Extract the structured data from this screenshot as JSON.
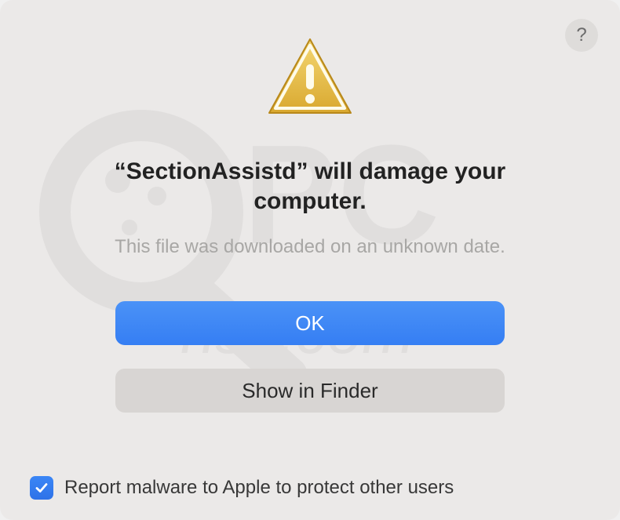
{
  "dialog": {
    "title": "“SectionAssistd” will damage your computer.",
    "subtitle": "This file was downloaded on an unknown date.",
    "primary_button": "OK",
    "secondary_button": "Show in Finder",
    "checkbox_label": "Report malware to Apple to protect other users",
    "checkbox_checked": true,
    "help_label": "?"
  },
  "icons": {
    "warning": "warning-triangle",
    "help": "help-circle",
    "checkmark": "checkmark"
  }
}
